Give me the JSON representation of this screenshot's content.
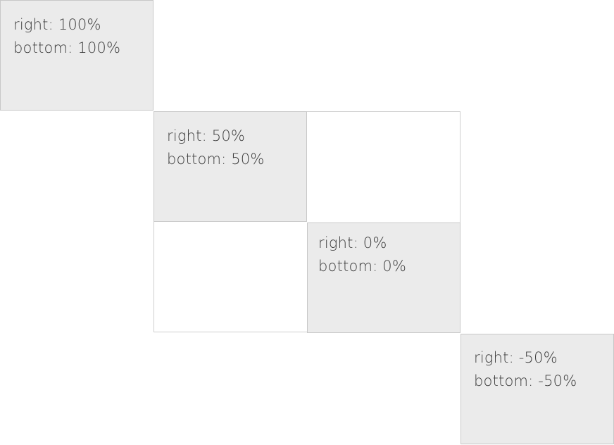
{
  "boxes": [
    {
      "line1": "right: 100%",
      "line2": "bottom: 100%"
    },
    {
      "line1": "right: 50%",
      "line2": "bottom: 50%"
    },
    {
      "line1": "right: 0%",
      "line2": "bottom: 0%"
    },
    {
      "line1": "right: -50%",
      "line2": "bottom: -50%"
    }
  ],
  "colors": {
    "box_fill": "#ebebeb",
    "box_border": "#c8c8c8",
    "container_border": "#cfcfcf",
    "text": "#3d3d3d"
  }
}
